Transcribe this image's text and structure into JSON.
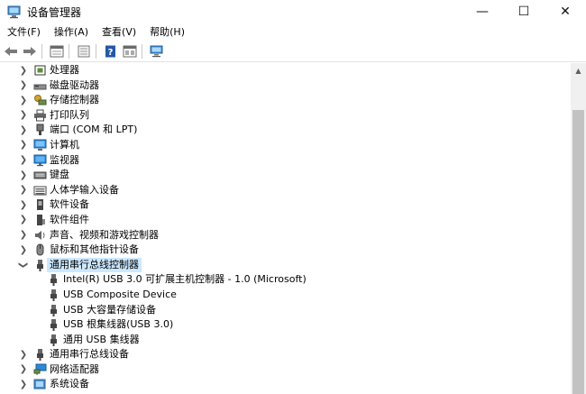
{
  "window": {
    "title": "设备管理器",
    "controls": {
      "minimize": "—",
      "maximize": "☐",
      "close": "✕"
    }
  },
  "menu": [
    {
      "name": "menu-file",
      "label": "文件(F)"
    },
    {
      "name": "menu-action",
      "label": "操作(A)"
    },
    {
      "name": "menu-view",
      "label": "查看(V)"
    },
    {
      "name": "menu-help",
      "label": "帮助(H)"
    }
  ],
  "toolbar": {
    "icons": [
      "back-arrow-icon",
      "forward-arrow-icon",
      "properties-icon",
      "update-driver-icon",
      "help-icon",
      "view-icon",
      "scan-hardware-icon"
    ]
  },
  "tree": [
    {
      "level": 0,
      "expanded": false,
      "label": "处理器",
      "icon": "processor-icon"
    },
    {
      "level": 0,
      "expanded": false,
      "label": "磁盘驱动器",
      "icon": "disk-drive-icon"
    },
    {
      "level": 0,
      "expanded": false,
      "label": "存储控制器",
      "icon": "storage-controller-icon"
    },
    {
      "level": 0,
      "expanded": false,
      "label": "打印队列",
      "icon": "printer-icon"
    },
    {
      "level": 0,
      "expanded": false,
      "label": "端口 (COM 和 LPT)",
      "icon": "port-icon"
    },
    {
      "level": 0,
      "expanded": false,
      "label": "计算机",
      "icon": "computer-icon"
    },
    {
      "level": 0,
      "expanded": false,
      "label": "监视器",
      "icon": "monitor-icon"
    },
    {
      "level": 0,
      "expanded": false,
      "label": "键盘",
      "icon": "keyboard-icon"
    },
    {
      "level": 0,
      "expanded": false,
      "label": "人体学输入设备",
      "icon": "hid-icon"
    },
    {
      "level": 0,
      "expanded": false,
      "label": "软件设备",
      "icon": "software-device-icon"
    },
    {
      "level": 0,
      "expanded": false,
      "label": "软件组件",
      "icon": "software-component-icon"
    },
    {
      "level": 0,
      "expanded": false,
      "label": "声音、视频和游戏控制器",
      "icon": "sound-icon"
    },
    {
      "level": 0,
      "expanded": false,
      "label": "鼠标和其他指针设备",
      "icon": "mouse-icon"
    },
    {
      "level": 0,
      "expanded": true,
      "selected": true,
      "label": "通用串行总线控制器",
      "icon": "usb-icon"
    },
    {
      "level": 1,
      "label": "Intel(R) USB 3.0 可扩展主机控制器 - 1.0 (Microsoft)",
      "icon": "usb-icon"
    },
    {
      "level": 1,
      "label": "USB Composite Device",
      "icon": "usb-icon"
    },
    {
      "level": 1,
      "label": "USB 大容量存储设备",
      "icon": "usb-icon"
    },
    {
      "level": 1,
      "label": "USB 根集线器(USB 3.0)",
      "icon": "usb-icon"
    },
    {
      "level": 1,
      "label": "通用 USB 集线器",
      "icon": "usb-icon"
    },
    {
      "level": 0,
      "expanded": false,
      "label": "通用串行总线设备",
      "icon": "usb-icon"
    },
    {
      "level": 0,
      "expanded": false,
      "label": "网络适配器",
      "icon": "network-adapter-icon"
    },
    {
      "level": 0,
      "expanded": false,
      "label": "系统设备",
      "icon": "system-device-icon"
    }
  ],
  "colors": {
    "selection": "#cce8ff",
    "accent_blue": "#1f6fc5",
    "monitor_blue": "#2a8ad8",
    "scroll_track": "#f0f0f0",
    "scroll_thumb": "#c2c2c2"
  }
}
